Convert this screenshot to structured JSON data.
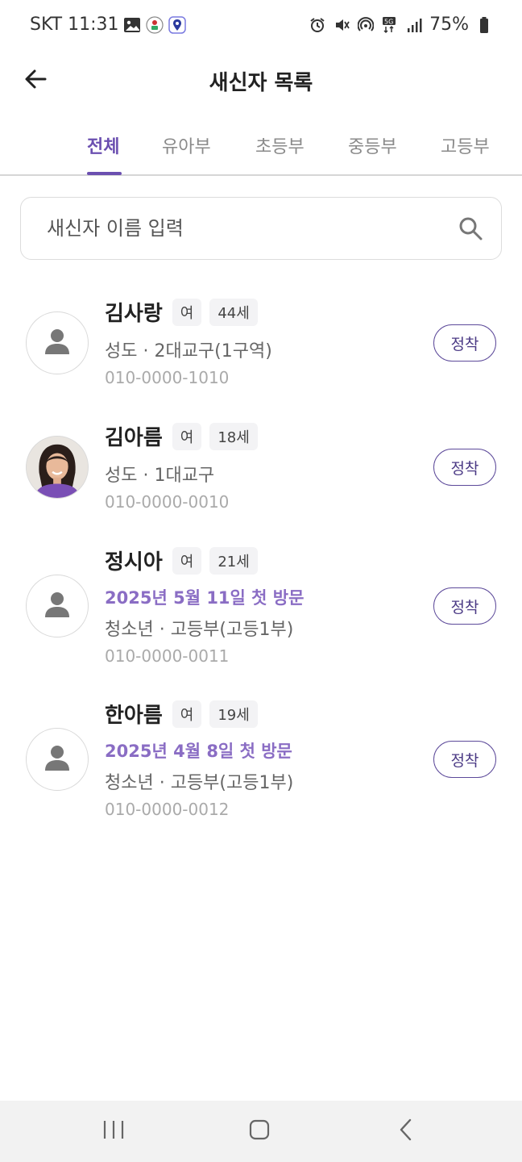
{
  "status_bar": {
    "time": "SKT 11:31",
    "battery": "75%",
    "icons": [
      "image-icon",
      "app-icon",
      "map-pin-icon",
      "alarm-icon",
      "mute-icon",
      "hotspot-icon",
      "5g-icon",
      "signal-icon",
      "battery-icon"
    ]
  },
  "app_bar": {
    "title": "새신자 목록",
    "back_icon": "arrow-left-icon"
  },
  "tabs": [
    {
      "label": "전체",
      "active": true
    },
    {
      "label": "유아부",
      "active": false
    },
    {
      "label": "초등부",
      "active": false
    },
    {
      "label": "중등부",
      "active": false
    },
    {
      "label": "고등부",
      "active": false
    }
  ],
  "search": {
    "placeholder": "새신자 이름 입력",
    "value": "",
    "icon": "search-icon"
  },
  "members": [
    {
      "name": "김사랑",
      "gender": "여",
      "age": "44세",
      "visit": "",
      "detail": "성도 · 2대교구(1구역)",
      "phone": "010-0000-1010",
      "avatar": "default",
      "action": "정착"
    },
    {
      "name": "김아름",
      "gender": "여",
      "age": "18세",
      "visit": "",
      "detail": "성도 · 1대교구",
      "phone": "010-0000-0010",
      "avatar": "photo",
      "action": "정착"
    },
    {
      "name": "정시아",
      "gender": "여",
      "age": "21세",
      "visit": "2025년 5월 11일 첫 방문",
      "detail": "청소년 · 고등부(고등1부)",
      "phone": "010-0000-0011",
      "avatar": "default",
      "action": "정착"
    },
    {
      "name": "한아름",
      "gender": "여",
      "age": "19세",
      "visit": "2025년 4월 8일 첫 방문",
      "detail": "청소년 · 고등부(고등1부)",
      "phone": "010-0000-0012",
      "avatar": "default",
      "action": "정착"
    }
  ],
  "colors": {
    "accent": "#6b4fb0",
    "visit_text": "#8a6dc4",
    "button_border": "#5d4a9a"
  },
  "nav_bar": {
    "icons": [
      "recent-apps-icon",
      "home-icon",
      "back-icon"
    ]
  }
}
